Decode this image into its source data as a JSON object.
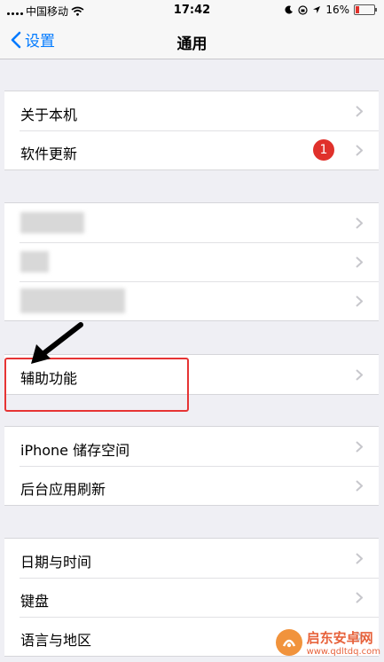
{
  "status_bar": {
    "carrier": "中国移动",
    "time": "17:42",
    "battery": "16%"
  },
  "nav": {
    "back_label": "设置",
    "title": "通用"
  },
  "groups": [
    {
      "rows": [
        {
          "label": "关于本机"
        },
        {
          "label": "软件更新",
          "badge": "1"
        }
      ]
    },
    {
      "rows": [
        {
          "label": ""
        },
        {
          "label": ""
        },
        {
          "label": ""
        }
      ]
    },
    {
      "rows": [
        {
          "label": "辅助功能"
        }
      ]
    },
    {
      "rows": [
        {
          "label": "iPhone 储存空间"
        },
        {
          "label": "后台应用刷新"
        }
      ]
    },
    {
      "rows": [
        {
          "label": "日期与时间"
        },
        {
          "label": "键盘"
        },
        {
          "label": "语言与地区"
        }
      ]
    }
  ],
  "watermark": {
    "title": "启东安卓网",
    "url": "www.qdltdq.com"
  },
  "colors": {
    "accent": "#007aff",
    "badge": "#e0312b",
    "highlight": "#e63434"
  }
}
